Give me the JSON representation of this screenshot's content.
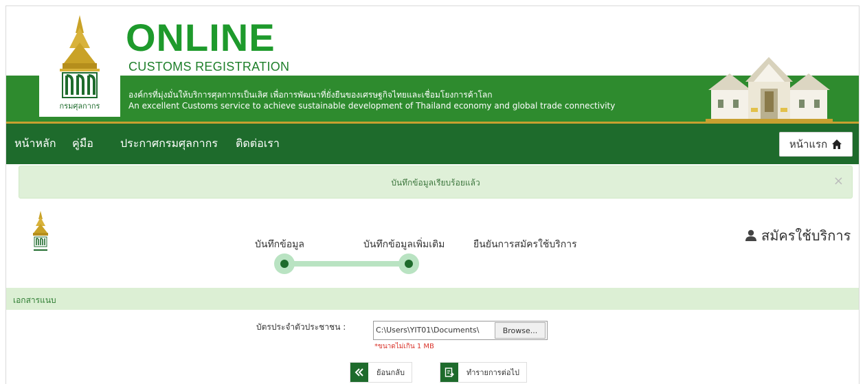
{
  "header": {
    "logo_text": "กรมศุลกากร",
    "title": "ONLINE",
    "subtitle": "CUSTOMS REGISTRATION",
    "tagline_th": "องค์กรที่มุ่งมั่นให้บริการศุลกากรเป็นเลิศ เพื่อการพัฒนาที่ยั่งยืนของเศรษฐกิจไทยและเชื่อมโยงการค้าโลก",
    "tagline_en": "An excellent Customs service to achieve sustainable development of Thailand economy and global trade connectivity"
  },
  "nav": {
    "items": [
      "หน้าหลัก",
      "คู่มือ",
      "ประกาศกรมศุลกากร",
      "ติดต่อเรา"
    ],
    "home_button": "หน้าแรก"
  },
  "alert": {
    "message": "บันทึกข้อมูลเรียบร้อยแล้ว",
    "close": "×"
  },
  "steps": {
    "title": "สมัครใช้บริการ",
    "items": [
      "บันทึกข้อมูล",
      "บันทึกข้อมูลเพิ่มเติม",
      "ยืนยันการสมัครใช้บริการ"
    ]
  },
  "section": {
    "title": "เอกสารแนบ",
    "field_label": "บัตรประจำตัวประชาชน :",
    "file_value": "C:\\Users\\YIT01\\Documents\\",
    "browse": "Browse...",
    "size_note": "*ขนาดไม่เกิน 1 MB"
  },
  "buttons": {
    "back": "ย้อนกลับ",
    "next": "ทำรายการต่อไป"
  },
  "colors": {
    "header_green": "#2e8b2e",
    "nav_green": "#1e6b2c",
    "accent_gold": "#c8a030",
    "success_bg": "#dff0d8"
  }
}
